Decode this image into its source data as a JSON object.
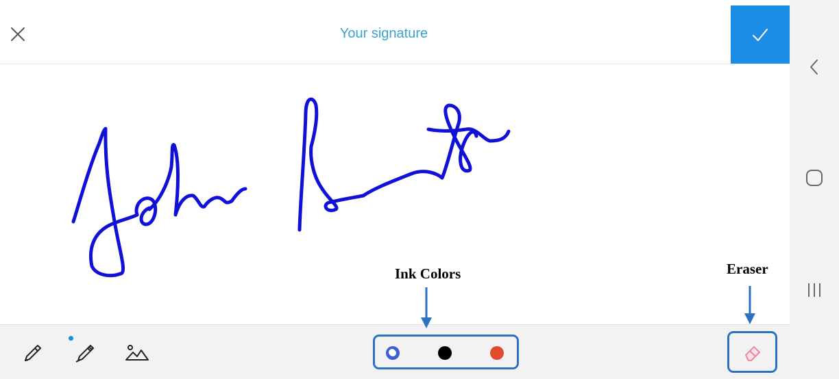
{
  "header": {
    "title": "Your signature",
    "close_icon": "close-icon",
    "confirm_icon": "checkmark-icon"
  },
  "canvas": {
    "signature_text": "John Smith",
    "ink_color": "#1010d6"
  },
  "toolbar": {
    "tools": [
      "pen-icon",
      "marker-icon",
      "image-icon"
    ],
    "active_tool": "marker-icon",
    "colors": [
      "#3a5fd9",
      "#000000",
      "#e04a2e"
    ],
    "selected_color": "#3a5fd9",
    "eraser_icon": "eraser-icon"
  },
  "annotations": {
    "ink_colors_label": "Ink Colors",
    "eraser_label": "Eraser",
    "accent": "#2b73c1"
  },
  "system_nav": [
    "back-icon",
    "home-icon",
    "recents-icon"
  ]
}
